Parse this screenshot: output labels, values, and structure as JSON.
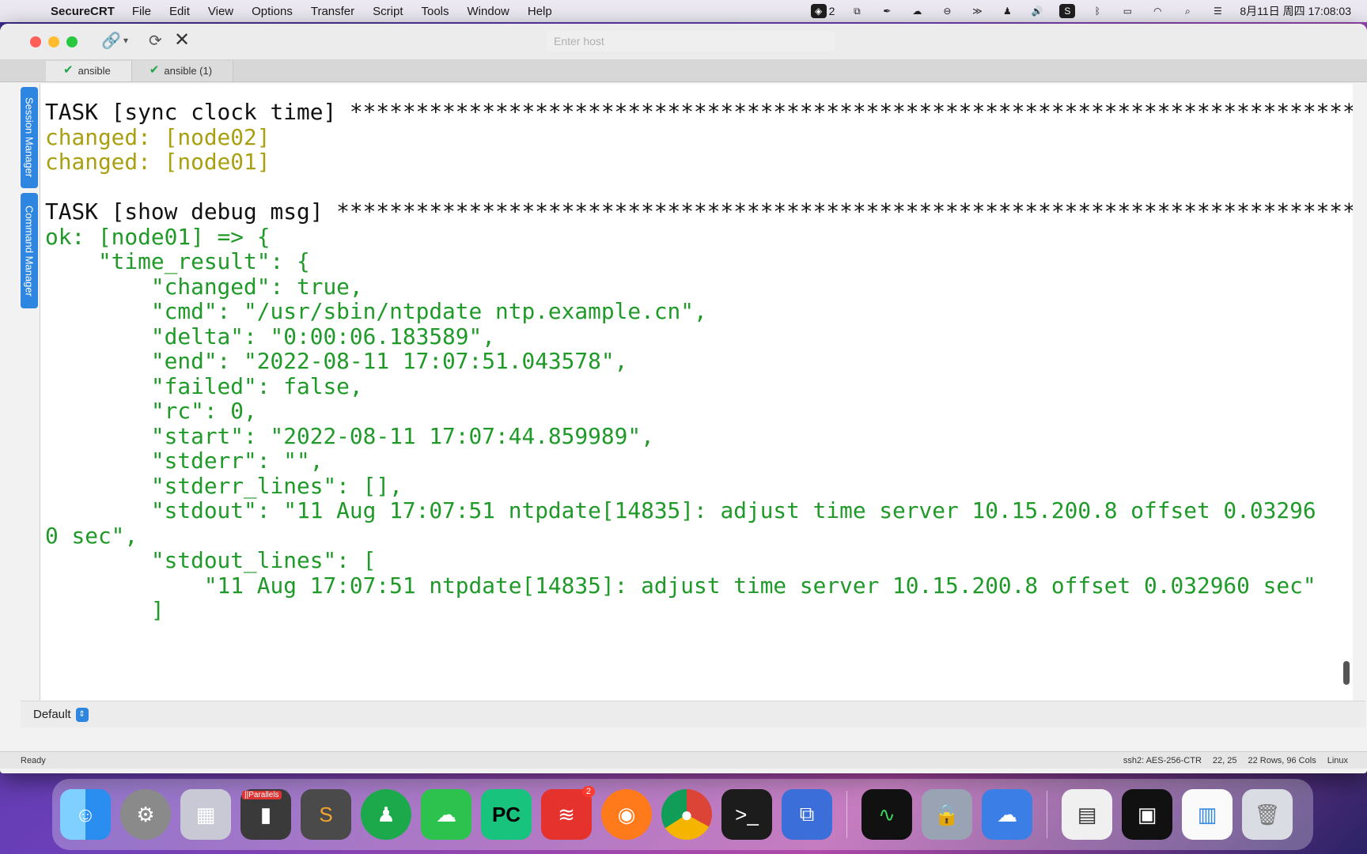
{
  "menubar": {
    "app_name": "SecureCRT",
    "items": [
      "File",
      "Edit",
      "View",
      "Options",
      "Transfer",
      "Script",
      "Tools",
      "Window",
      "Help"
    ],
    "status_badge_count": "2",
    "datetime": "8月11日 周四 17:08:03"
  },
  "window": {
    "host_placeholder": "Enter host",
    "tabs": [
      {
        "label": "ansible"
      },
      {
        "label": "ansible (1)"
      }
    ],
    "side_tabs": [
      "Session Manager",
      "Command Manager"
    ],
    "profile": "Default"
  },
  "terminal": {
    "lines": [
      {
        "text": "TASK [sync clock time] *****************************************************************************",
        "color": "black"
      },
      {
        "text": "changed: [node02]",
        "color": "yellow"
      },
      {
        "text": "changed: [node01]",
        "color": "yellow"
      },
      {
        "text": "",
        "color": "black"
      },
      {
        "text": "TASK [show debug msg] ******************************************************************************",
        "color": "black"
      },
      {
        "text": "ok: [node01] => {",
        "color": "green"
      },
      {
        "text": "    \"time_result\": {",
        "color": "green"
      },
      {
        "text": "        \"changed\": true,",
        "color": "green"
      },
      {
        "text": "        \"cmd\": \"/usr/sbin/ntpdate ntp.example.cn\",",
        "color": "green"
      },
      {
        "text": "        \"delta\": \"0:00:06.183589\",",
        "color": "green"
      },
      {
        "text": "        \"end\": \"2022-08-11 17:07:51.043578\",",
        "color": "green"
      },
      {
        "text": "        \"failed\": false,",
        "color": "green"
      },
      {
        "text": "        \"rc\": 0,",
        "color": "green"
      },
      {
        "text": "        \"start\": \"2022-08-11 17:07:44.859989\",",
        "color": "green"
      },
      {
        "text": "        \"stderr\": \"\",",
        "color": "green"
      },
      {
        "text": "        \"stderr_lines\": [],",
        "color": "green"
      },
      {
        "text": "        \"stdout\": \"11 Aug 17:07:51 ntpdate[14835]: adjust time server 10.15.200.8 offset 0.03296",
        "color": "green"
      },
      {
        "text": "0 sec\",",
        "color": "green"
      },
      {
        "text": "        \"stdout_lines\": [",
        "color": "green"
      },
      {
        "text": "            \"11 Aug 17:07:51 ntpdate[14835]: adjust time server 10.15.200.8 offset 0.032960 sec\"",
        "color": "green"
      },
      {
        "text": "        ]",
        "color": "green"
      }
    ]
  },
  "statusbar": {
    "left": "Ready",
    "cipher": "ssh2: AES-256-CTR",
    "cursor": "22, 25",
    "size": "22 Rows, 96 Cols",
    "os": "Linux"
  },
  "dock": {
    "parallels_label": "||Parallels",
    "badge_count": "2"
  },
  "colors": {
    "yellow": "#a9a011",
    "green": "#1f9a28",
    "black": "#111111",
    "accent": "#2e86e0"
  }
}
